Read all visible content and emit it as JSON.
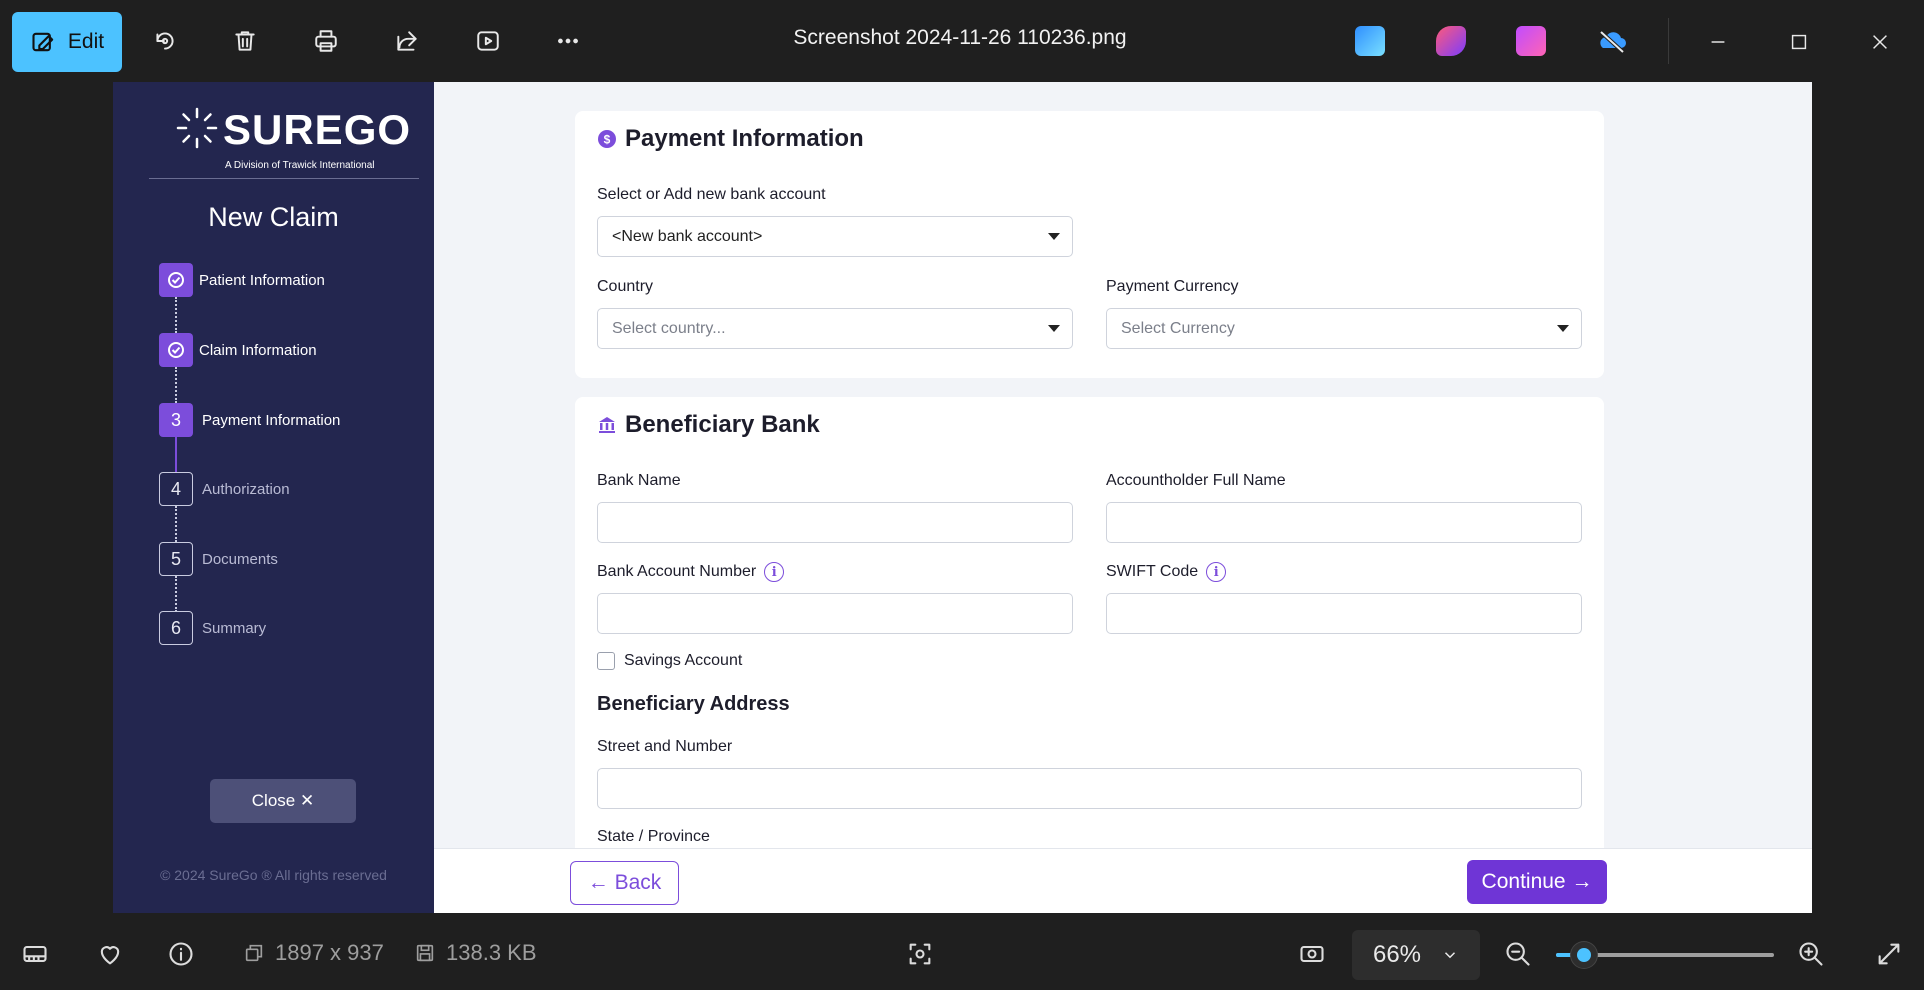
{
  "viewer": {
    "edit_label": "Edit",
    "title": "Screenshot 2024-11-26 110236.png",
    "accent_color": "#4cc2ff"
  },
  "sidebar": {
    "brand": "SUREGO",
    "brand_sub": "A Division of Trawick International",
    "heading": "New Claim",
    "steps": [
      {
        "marker": "",
        "label": "Patient Information",
        "state": "done"
      },
      {
        "marker": "",
        "label": "Claim Information",
        "state": "done"
      },
      {
        "marker": "3",
        "label": "Payment Information",
        "state": "current"
      },
      {
        "marker": "4",
        "label": "Authorization",
        "state": "todo"
      },
      {
        "marker": "5",
        "label": "Documents",
        "state": "todo"
      },
      {
        "marker": "6",
        "label": "Summary",
        "state": "todo"
      }
    ],
    "close_label": "Close ✕",
    "copyright": "© 2024 SureGo ® All rights reserved",
    "bg_color": "#23264f",
    "accent_color": "#7c4ddb"
  },
  "payment": {
    "title": "Payment Information",
    "bank_select_label": "Select or Add new bank account",
    "bank_select_value": "<New bank account>",
    "country_label": "Country",
    "country_placeholder": "Select country...",
    "currency_label": "Payment Currency",
    "currency_placeholder": "Select Currency"
  },
  "beneficiary": {
    "title": "Beneficiary Bank",
    "bank_name_label": "Bank Name",
    "holder_label": "Accountholder Full Name",
    "account_number_label": "Bank Account Number",
    "swift_label": "SWIFT Code",
    "savings_label": "Savings Account",
    "address_title": "Beneficiary Address",
    "street_label": "Street and Number",
    "state_label": "State / Province"
  },
  "footer": {
    "back_label": "← Back",
    "continue_label": "Continue →"
  },
  "status": {
    "dimensions": "1897 x 937",
    "file_size": "138.3 KB",
    "zoom": "66%",
    "zoom_level_fraction": 0.13
  }
}
